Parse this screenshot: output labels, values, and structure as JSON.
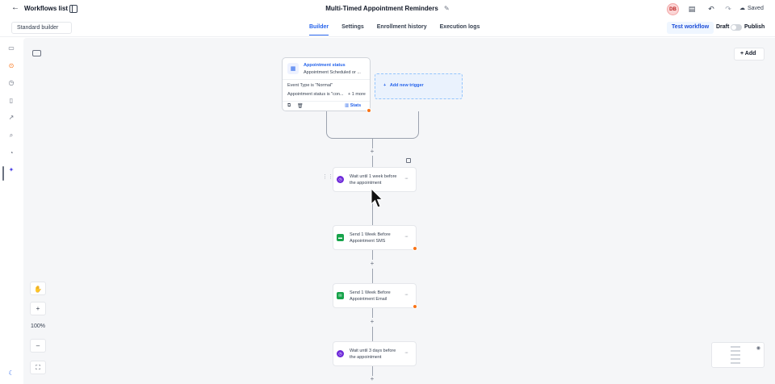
{
  "header": {
    "back_label": "Workflows list",
    "title": "Multi-Timed Appointment Reminders",
    "avatar_initials": "DB",
    "saved_label": "Saved"
  },
  "subbar": {
    "builder_select": "Standard builder",
    "tabs": [
      {
        "label": "Builder",
        "active": true
      },
      {
        "label": "Settings",
        "active": false
      },
      {
        "label": "Enrollment history",
        "active": false
      },
      {
        "label": "Execution logs",
        "active": false
      }
    ],
    "test_workflow_label": "Test workflow",
    "draft_label": "Draft",
    "publish_label": "Publish"
  },
  "canvas": {
    "add_label": "Add",
    "zoom_level": "100%",
    "zoom_in": "+",
    "zoom_out": "–",
    "trigger": {
      "title": "Appointment status",
      "subtitle": "Appointment Scheduled or ...",
      "condition1": "Event Type is \"Normal\"",
      "condition2": "Appointment status is \"con...",
      "more": "+ 1 more",
      "stats_label": "Stats"
    },
    "add_trigger_label": "Add new trigger",
    "steps": [
      {
        "line1": "Wait until 1 week before",
        "line2": "the appointment",
        "icon": "clock-icon"
      },
      {
        "line1": "Send 1 Week Before",
        "line2": "Appointment SMS",
        "icon": "sms-icon"
      },
      {
        "line1": "Send 1 Week Before",
        "line2": "Appointment Email",
        "icon": "email-icon"
      },
      {
        "line1": "Wait until 3 days before",
        "line2": "the appointment",
        "icon": "clock-icon"
      }
    ],
    "plus": "+"
  },
  "colors": {
    "accent": "#2563eb",
    "warning": "#f97316",
    "wait": "#6d28d9",
    "action": "#16a34a"
  }
}
